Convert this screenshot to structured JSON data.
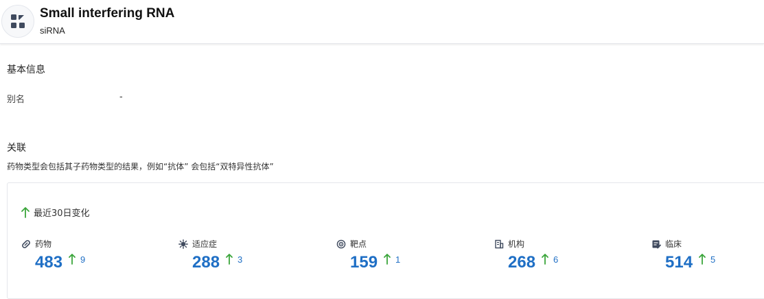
{
  "header": {
    "title": "Small interfering RNA",
    "subtitle": "siRNA",
    "icon": "molecule-icon"
  },
  "basic_info": {
    "section_title": "基本信息",
    "alias_label": "别名",
    "alias_value": "-"
  },
  "related": {
    "section_title": "关联",
    "note": "药物类型会包括其子药物类型的结果，例如“抗体” 会包括“双特异性抗体”",
    "change_label": "最近30日变化",
    "colors": {
      "number": "#1f6fc5",
      "up_arrow": "#3aa53a"
    },
    "stats": [
      {
        "label": "药物",
        "icon": "pill-icon",
        "value": "483",
        "delta": "9"
      },
      {
        "label": "适应症",
        "icon": "virus-icon",
        "value": "288",
        "delta": "3"
      },
      {
        "label": "靶点",
        "icon": "target-icon",
        "value": "159",
        "delta": "1"
      },
      {
        "label": "机构",
        "icon": "building-icon",
        "value": "268",
        "delta": "6"
      },
      {
        "label": "临床",
        "icon": "clinical-icon",
        "value": "514",
        "delta": "5"
      }
    ]
  }
}
